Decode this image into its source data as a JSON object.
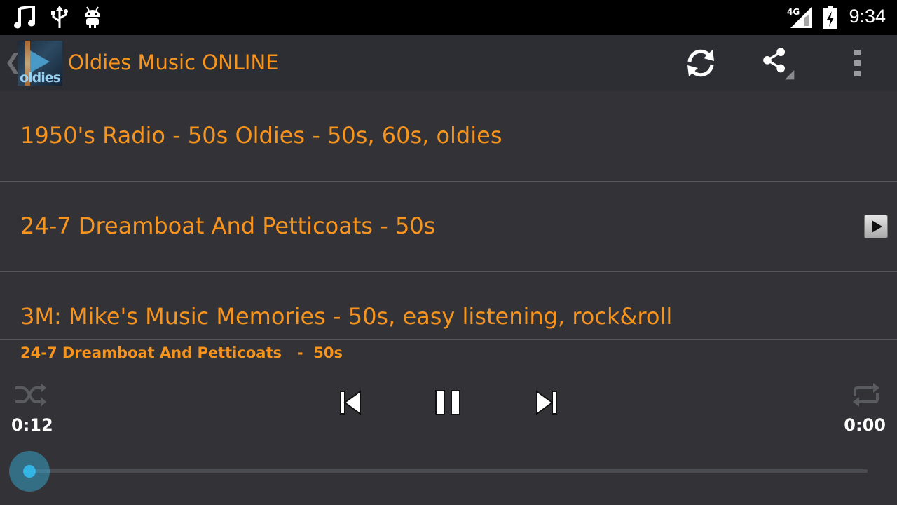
{
  "status_bar": {
    "network": "4G",
    "time": "9:34",
    "icons": [
      "music-note-icon",
      "usb-icon",
      "android-icon",
      "signal-icon",
      "battery-charging-icon"
    ]
  },
  "action_bar": {
    "back_glyph": "❮",
    "logo_text": "oldies",
    "title": "Oldies Music ONLINE",
    "actions": [
      "refresh-icon",
      "share-icon",
      "overflow-menu-icon"
    ]
  },
  "stations": [
    {
      "label": "1950's Radio - 50s Oldies  - 50s, 60s, oldies"
    },
    {
      "label": "24-7 Dreamboat And Petticoats  - 50s",
      "playing": true
    },
    {
      "label": "3M: Mike's Music Memories - 50s, easy listening, rock&roll"
    }
  ],
  "player": {
    "now_playing": "24-7 Dreamboat And Petticoats   -  50s",
    "elapsed": "0:12",
    "duration": "0:00",
    "progress": 0,
    "controls": [
      "shuffle-icon",
      "previous-icon",
      "pause-icon",
      "next-icon",
      "repeat-icon"
    ]
  },
  "colors": {
    "accent": "#f7941d",
    "background": "#333337",
    "action_bar": "#2c2e34",
    "seek": "#33b5e5"
  }
}
